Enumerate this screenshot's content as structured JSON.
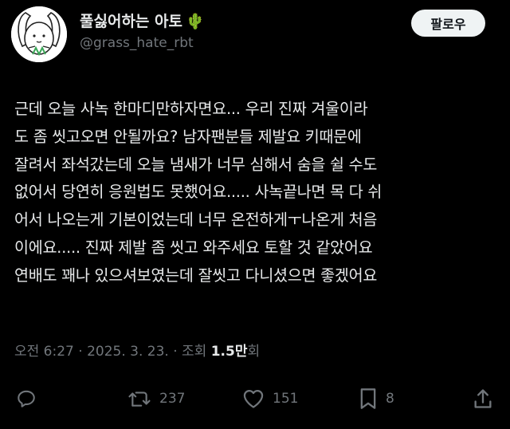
{
  "profile": {
    "display_name": "풀싫어하는 아토",
    "name_emoji": "🌵",
    "handle": "@grass_hate_rbt",
    "avatar_icon": "rabbit-cartoon-avatar"
  },
  "follow_button": {
    "label": "팔로우"
  },
  "tweet": {
    "lines": [
      "근데 오늘 사녹 한마디만하자면요... 우리 진짜 겨울이라",
      "도 좀 씻고오면 안될까요? 남자팬분들 제발요 키때문에",
      "잘려서 좌석갔는데 오늘 냄새가 너무 심해서 숨을 쉴 수도",
      "없어서 당연히 응원법도 못했어요..... 사녹끝나면 목 다 쉬",
      "어서 나오는게 기본이었는데 너무 온전하게ㅜ나온게 처음",
      "이에요..... 진짜 제발 좀 씻고 와주세요 토할 것 같았어요",
      "연배도 꽤나 있으셔보였는데 잘씻고 다니셨으면 좋겠어요"
    ]
  },
  "meta": {
    "time": "오전 6:27",
    "sep1": " · ",
    "date": "2025. 3. 23.",
    "sep2": " · ",
    "views_prefix": "조회 ",
    "views_count": "1.5만",
    "views_suffix": "회"
  },
  "actions": {
    "reply": {
      "icon": "reply-icon"
    },
    "retweet": {
      "icon": "retweet-icon",
      "count": "237"
    },
    "like": {
      "icon": "heart-icon",
      "count": "151"
    },
    "bookmark": {
      "icon": "bookmark-icon",
      "count": "8"
    },
    "share": {
      "icon": "share-icon"
    }
  },
  "colors": {
    "background": "#000000",
    "text": "#e7e9ea",
    "secondary": "#71767b",
    "follow_bg": "#eff3f4"
  }
}
